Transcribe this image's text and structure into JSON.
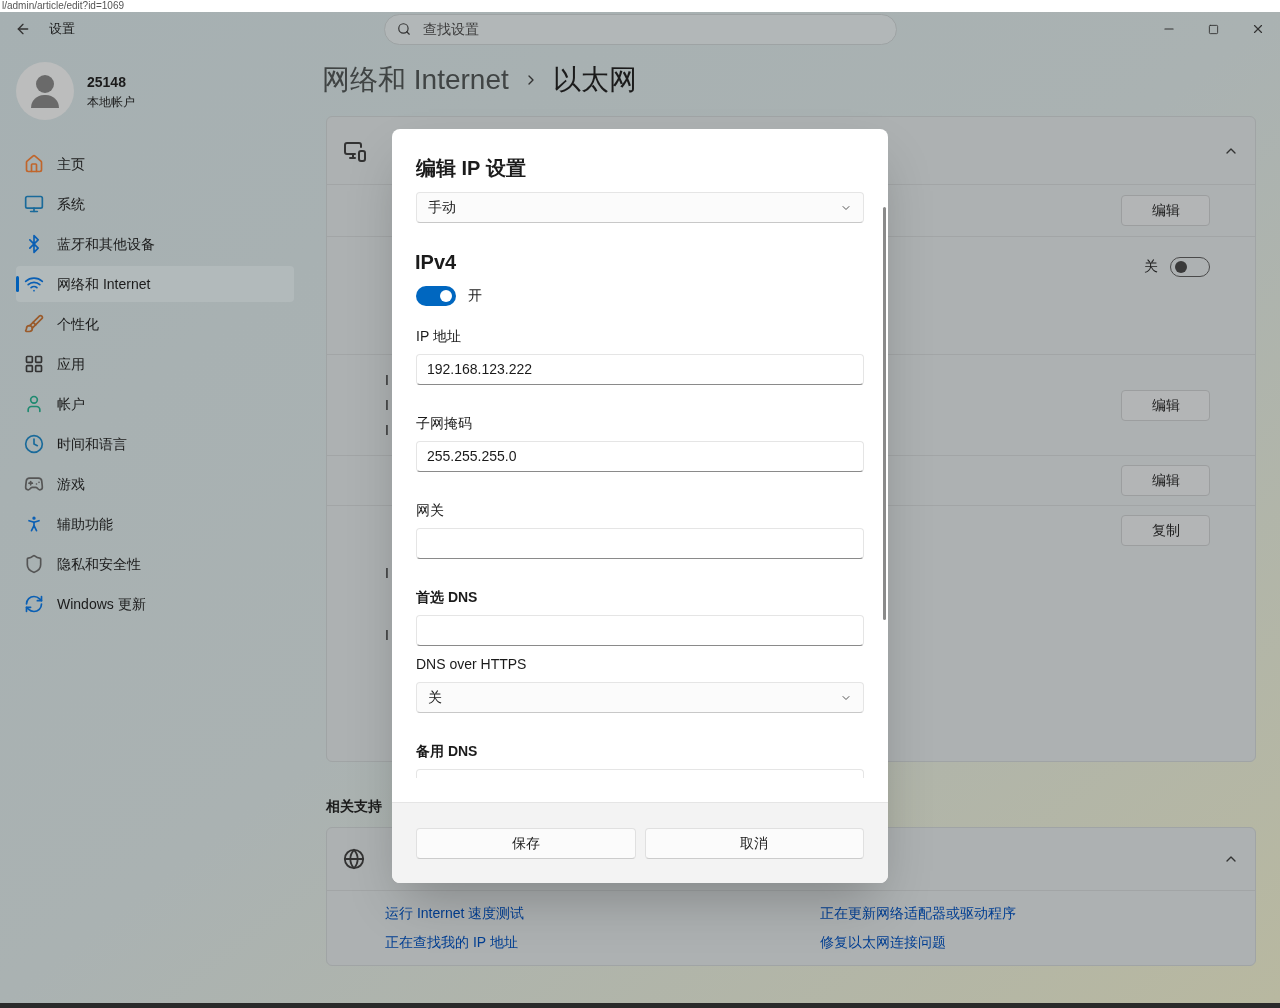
{
  "browser_url": "l/admin/article/edit?id=1069",
  "window": {
    "title": "设置"
  },
  "search": {
    "placeholder": "查找设置"
  },
  "account": {
    "name": "25148",
    "type": "本地帐户"
  },
  "sidebar": {
    "items": [
      {
        "label": "主页",
        "selected": false
      },
      {
        "label": "系统",
        "selected": false
      },
      {
        "label": "蓝牙和其他设备",
        "selected": false
      },
      {
        "label": "网络和 Internet",
        "selected": true
      },
      {
        "label": "个性化",
        "selected": false
      },
      {
        "label": "应用",
        "selected": false
      },
      {
        "label": "帐户",
        "selected": false
      },
      {
        "label": "时间和语言",
        "selected": false
      },
      {
        "label": "游戏",
        "selected": false
      },
      {
        "label": "辅助功能",
        "selected": false
      },
      {
        "label": "隐私和安全性",
        "selected": false
      },
      {
        "label": "Windows 更新",
        "selected": false
      }
    ]
  },
  "breadcrumb": [
    "网络和 Internet",
    "以太网"
  ],
  "ethernet_card": {
    "rows": [
      {
        "kind": "header",
        "expanded": true
      },
      {
        "kind": "button",
        "control_label": "编辑"
      },
      {
        "kind": "toggle",
        "on": false,
        "control_label": "关"
      },
      {
        "kind": "button",
        "control_label": "编辑",
        "groups": [
          [
            "I",
            "I",
            "I"
          ]
        ]
      },
      {
        "kind": "button",
        "control_label": "编辑"
      },
      {
        "kind": "button",
        "control_label": "复制",
        "groups": [
          [
            "I"
          ],
          [
            "I"
          ]
        ]
      }
    ]
  },
  "related": {
    "title": "相关支持",
    "expanded": true,
    "links": [
      "运行 Internet 速度测试",
      "正在更新网络适配器或驱动程序",
      "正在查找我的 IP 地址",
      "修复以太网连接问题"
    ]
  },
  "dialog": {
    "title": "编辑 IP 设置",
    "mode": "手动",
    "section": "IPv4",
    "section_on": true,
    "section_state": "开",
    "fields": [
      {
        "kind": "input",
        "label": "IP 地址",
        "value": "192.168.123.222"
      },
      {
        "kind": "input",
        "label": "子网掩码",
        "value": "255.255.255.0"
      },
      {
        "kind": "input",
        "label": "网关"
      },
      {
        "kind": "dns_input",
        "label": "首选 DNS"
      },
      {
        "kind": "select",
        "label": "DNS over HTTPS",
        "value": "关"
      },
      {
        "kind": "dns_input",
        "label": "备用 DNS"
      }
    ],
    "buttons": [
      "保存",
      "取消"
    ]
  }
}
